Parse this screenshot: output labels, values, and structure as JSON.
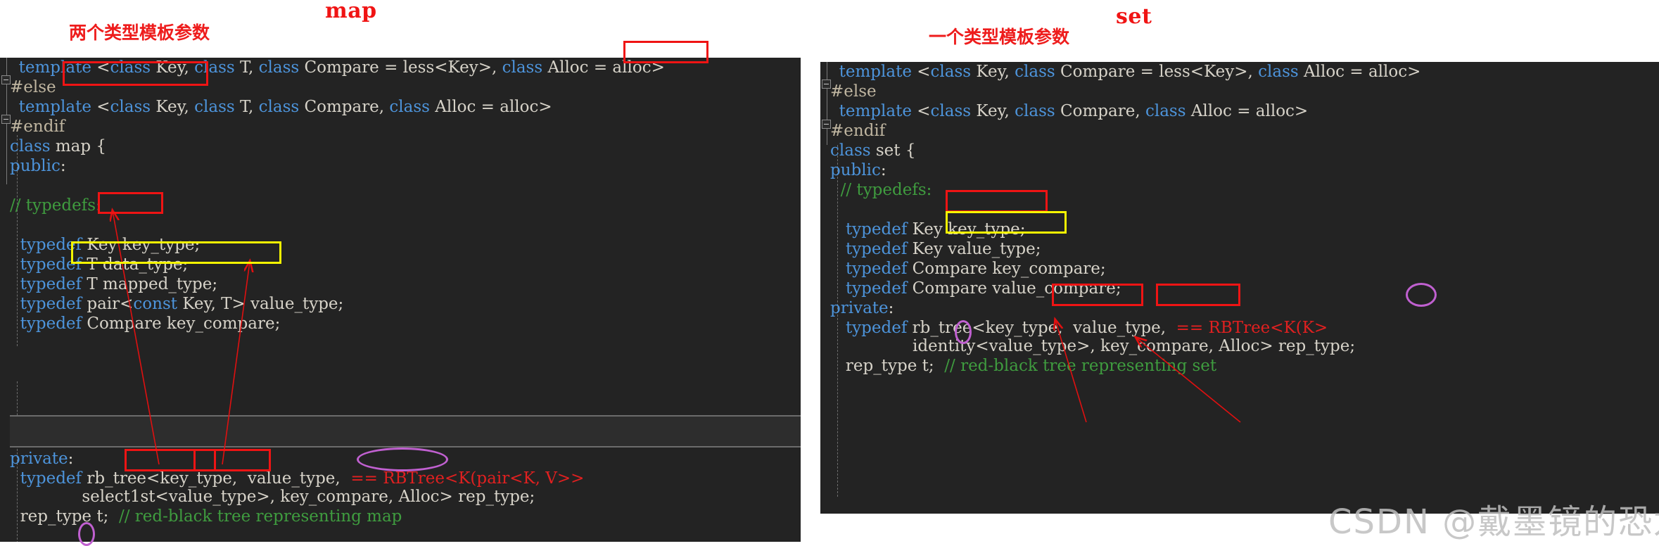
{
  "titles": {
    "map": "map",
    "set": "set"
  },
  "annotations": {
    "map_params": "两个类型模板参数",
    "set_params": "一个类型模板参数"
  },
  "watermark": "CSDN @戴墨镜的恐龙",
  "map_panel": {
    "lines": [
      {
        "id": "m1",
        "text": "  template <class Key, class T, class Compare = less<Key>, class Alloc = alloc>"
      },
      {
        "id": "m2",
        "text": "#else"
      },
      {
        "id": "m3",
        "text": "  template <class Key, class T, class Compare, class Alloc = alloc>"
      },
      {
        "id": "m4",
        "text": "#endif"
      },
      {
        "id": "m5",
        "text": "class map {"
      },
      {
        "id": "m6",
        "text": "public:"
      },
      {
        "id": "m7",
        "text": ""
      },
      {
        "id": "m8",
        "text": ""
      },
      {
        "id": "m9",
        "text": "// typedefs:"
      },
      {
        "id": "m10",
        "text": ""
      },
      {
        "id": "m11",
        "text": ""
      },
      {
        "id": "m12",
        "text": "  typedef Key key_type;"
      },
      {
        "id": "m13",
        "text": "  typedef T data_type;"
      },
      {
        "id": "m14",
        "text": "  typedef T mapped_type;"
      },
      {
        "id": "m15",
        "text": "  typedef pair<const Key, T> value_type;"
      },
      {
        "id": "m16",
        "text": "  typedef Compare key_compare;"
      },
      {
        "id": "m17",
        "text": ""
      },
      {
        "id": "m18",
        "text": "private:"
      },
      {
        "id": "m19",
        "text": "  typedef rb_tree<key_type,  value_type,  == RBTree<K(pair<K, V>>"
      },
      {
        "id": "m20",
        "text": "              select1st<value_type>, key_compare, Alloc> rep_type;"
      },
      {
        "id": "m21",
        "text": "  rep_type t;  // red-black tree representing map"
      }
    ],
    "segments": {
      "l1": [
        {
          "t": "  ",
          "c": "id"
        },
        {
          "t": "template",
          "c": "kw"
        },
        {
          "t": " <",
          "c": "id"
        },
        {
          "t": "class",
          "c": "kw"
        },
        {
          "t": " Key, ",
          "c": "id"
        },
        {
          "t": "class",
          "c": "kw"
        },
        {
          "t": " T, ",
          "c": "id"
        },
        {
          "t": "class",
          "c": "kw"
        },
        {
          "t": " Compare = less<Key>, ",
          "c": "id"
        },
        {
          "t": "class",
          "c": "kw"
        },
        {
          "t": " Alloc = alloc>",
          "c": "id"
        }
      ],
      "l2": [
        {
          "t": "#else",
          "c": "pp"
        }
      ],
      "l3": [
        {
          "t": "  ",
          "c": "id"
        },
        {
          "t": "template",
          "c": "kw"
        },
        {
          "t": " <",
          "c": "id"
        },
        {
          "t": "class",
          "c": "kw"
        },
        {
          "t": " Key, ",
          "c": "id"
        },
        {
          "t": "class",
          "c": "kw"
        },
        {
          "t": " T, ",
          "c": "id"
        },
        {
          "t": "class",
          "c": "kw"
        },
        {
          "t": " Compare, ",
          "c": "id"
        },
        {
          "t": "class",
          "c": "kw"
        },
        {
          "t": " Alloc = alloc>",
          "c": "id"
        }
      ],
      "l4": [
        {
          "t": "#endif",
          "c": "pp"
        }
      ],
      "l5": [
        {
          "t": "class",
          "c": "kw"
        },
        {
          "t": " map {",
          "c": "id"
        }
      ],
      "l6": [
        {
          "t": "public",
          "c": "kw"
        },
        {
          "t": ":",
          "c": "id"
        }
      ],
      "l9": [
        {
          "t": "// typedefs:",
          "c": "cm"
        }
      ],
      "l12": [
        {
          "t": "  ",
          "c": "id"
        },
        {
          "t": "typedef",
          "c": "kw"
        },
        {
          "t": " Key key_type;",
          "c": "id"
        }
      ],
      "l13": [
        {
          "t": "  ",
          "c": "id"
        },
        {
          "t": "typedef",
          "c": "kw"
        },
        {
          "t": " T data_type;",
          "c": "id"
        }
      ],
      "l14": [
        {
          "t": "  ",
          "c": "id"
        },
        {
          "t": "typedef",
          "c": "kw"
        },
        {
          "t": " T mapped_type;",
          "c": "id"
        }
      ],
      "l15": [
        {
          "t": "  ",
          "c": "id"
        },
        {
          "t": "typedef",
          "c": "kw"
        },
        {
          "t": " pair<",
          "c": "id"
        },
        {
          "t": "const",
          "c": "kw"
        },
        {
          "t": " Key, T> value_type;",
          "c": "id"
        }
      ],
      "l16": [
        {
          "t": "  ",
          "c": "id"
        },
        {
          "t": "typedef",
          "c": "kw"
        },
        {
          "t": " Compare key_compare;",
          "c": "id"
        }
      ],
      "l18": [
        {
          "t": "private",
          "c": "kw"
        },
        {
          "t": ":",
          "c": "id"
        }
      ],
      "l19": [
        {
          "t": "  ",
          "c": "id"
        },
        {
          "t": "typedef",
          "c": "kw"
        },
        {
          "t": " rb_tree<key_type,  value_type,  ",
          "c": "id"
        },
        {
          "t": "== RBTree<K(pair<K, V>>",
          "c": "rd"
        }
      ],
      "l20": [
        {
          "t": "              select1st<value_type>, key_compare, Alloc> rep_type;",
          "c": "id"
        }
      ],
      "l21": [
        {
          "t": "  rep_type t;  ",
          "c": "id"
        },
        {
          "t": "// red-black tree representing map",
          "c": "cm"
        }
      ]
    }
  },
  "set_panel": {
    "segments": {
      "s1": [
        {
          "t": "  ",
          "c": "id"
        },
        {
          "t": "template",
          "c": "kw"
        },
        {
          "t": " <",
          "c": "id"
        },
        {
          "t": "class",
          "c": "kw"
        },
        {
          "t": " Key, ",
          "c": "id"
        },
        {
          "t": "class",
          "c": "kw"
        },
        {
          "t": " Compare = less<Key>, ",
          "c": "id"
        },
        {
          "t": "class",
          "c": "kw"
        },
        {
          "t": " Alloc = alloc>",
          "c": "id"
        }
      ],
      "s2": [
        {
          "t": "#else",
          "c": "pp"
        }
      ],
      "s3": [
        {
          "t": "  ",
          "c": "id"
        },
        {
          "t": "template",
          "c": "kw"
        },
        {
          "t": " <",
          "c": "id"
        },
        {
          "t": "class",
          "c": "kw"
        },
        {
          "t": " Key, ",
          "c": "id"
        },
        {
          "t": "class",
          "c": "kw"
        },
        {
          "t": " Compare, ",
          "c": "id"
        },
        {
          "t": "class",
          "c": "kw"
        },
        {
          "t": " Alloc = alloc>",
          "c": "id"
        }
      ],
      "s4": [
        {
          "t": "#endif",
          "c": "pp"
        }
      ],
      "s5": [
        {
          "t": "class",
          "c": "kw"
        },
        {
          "t": " set {",
          "c": "id"
        }
      ],
      "s6": [
        {
          "t": "public",
          "c": "kw"
        },
        {
          "t": ":",
          "c": "id"
        }
      ],
      "s7": [
        {
          "t": "  ",
          "c": "id"
        },
        {
          "t": "// typedefs:",
          "c": "cm"
        }
      ],
      "s10": [
        {
          "t": "   ",
          "c": "id"
        },
        {
          "t": "typedef",
          "c": "kw"
        },
        {
          "t": " Key key_type;",
          "c": "id"
        }
      ],
      "s11": [
        {
          "t": "   ",
          "c": "id"
        },
        {
          "t": "typedef",
          "c": "kw"
        },
        {
          "t": " Key value_type;",
          "c": "id"
        }
      ],
      "s12": [
        {
          "t": "   ",
          "c": "id"
        },
        {
          "t": "typedef",
          "c": "kw"
        },
        {
          "t": " Compare key_compare;",
          "c": "id"
        }
      ],
      "s13": [
        {
          "t": "   ",
          "c": "id"
        },
        {
          "t": "typedef",
          "c": "kw"
        },
        {
          "t": " Compare value_compare;",
          "c": "id"
        }
      ],
      "s14": [
        {
          "t": "private",
          "c": "kw"
        },
        {
          "t": ":",
          "c": "id"
        }
      ],
      "s15": [
        {
          "t": "   ",
          "c": "id"
        },
        {
          "t": "typedef",
          "c": "kw"
        },
        {
          "t": " rb_tree<key_type,  value_type,  ",
          "c": "id"
        },
        {
          "t": "== RBTree<K(K>",
          "c": "rd"
        }
      ],
      "s16": [
        {
          "t": "                identity<value_type>, key_compare, Alloc> rep_type;",
          "c": "id"
        }
      ],
      "s17": [
        {
          "t": "   rep_type t;  ",
          "c": "id"
        },
        {
          "t": "// red-black tree representing set",
          "c": "cm"
        }
      ]
    }
  },
  "colors": {
    "panel_bg": "#232323",
    "keyword": "#4d94db",
    "identifier": "#d6d2c8",
    "preprocessor": "#bfb5a0",
    "comment": "#3f9c3f",
    "annotation_red": "#ef1414",
    "annotation_yellow": "#f5f500",
    "annotation_purple": "#c060d0"
  }
}
